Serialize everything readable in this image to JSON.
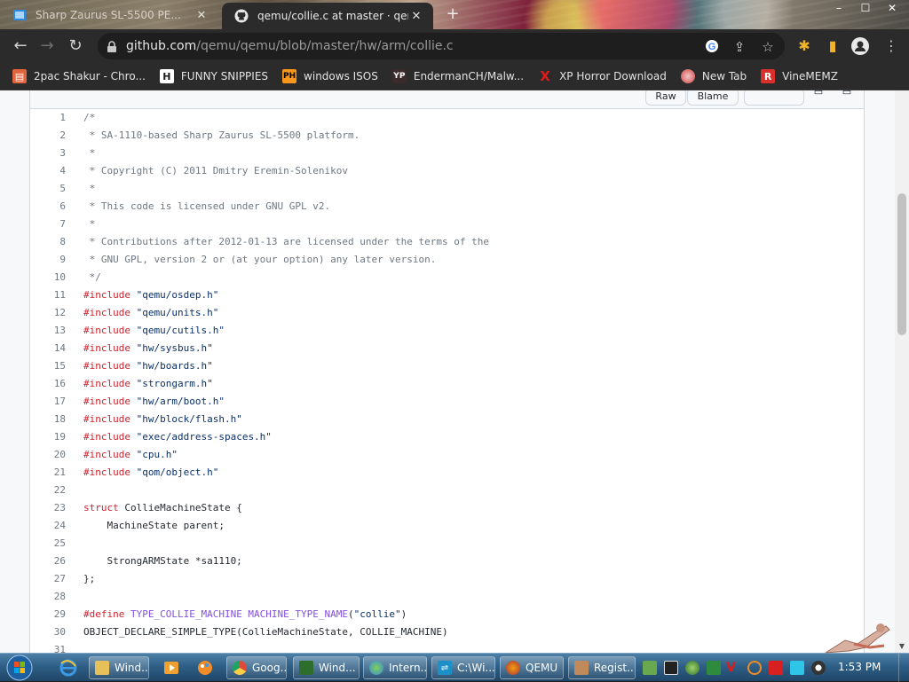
{
  "tabs": [
    {
      "title": "Sharp Zaurus SL-5500 PE...",
      "active": false
    },
    {
      "title": "qemu/collie.c at master · qemu/...",
      "active": true
    }
  ],
  "window_controls": {
    "minimize": "–",
    "maximize": "☐",
    "close": "✕"
  },
  "address_bar": {
    "host": "github.com",
    "path": "/qemu/qemu/blob/master/hw/arm/collie.c"
  },
  "bookmarks": [
    {
      "label": "2pac Shakur - Chro...",
      "icon": "ie-icon",
      "color": "#e0643c"
    },
    {
      "label": "FUNNY SNIPPIES",
      "icon": "H",
      "color": "#1a1a1a"
    },
    {
      "label": "windows ISOS",
      "icon": "PH",
      "color": "#f7971e"
    },
    {
      "label": "EndermanCH/Malw...",
      "icon": "YP",
      "color": "#3a2a2a"
    },
    {
      "label": "XP Horror Download",
      "icon": "X",
      "color": "#cc1111"
    },
    {
      "label": "New Tab",
      "icon": "globe",
      "color": "#c44"
    },
    {
      "label": "VineMEMZ",
      "icon": "R",
      "color": "#d9302b"
    }
  ],
  "file_header": {
    "raw": "Raw",
    "blame": "Blame"
  },
  "code_lines": [
    {
      "n": "1",
      "parts": [
        {
          "t": "/*",
          "c": "c-com"
        }
      ]
    },
    {
      "n": "2",
      "parts": [
        {
          "t": " * SA-1110-based Sharp Zaurus SL-5500 platform.",
          "c": "c-com"
        }
      ]
    },
    {
      "n": "3",
      "parts": [
        {
          "t": " *",
          "c": "c-com"
        }
      ]
    },
    {
      "n": "4",
      "parts": [
        {
          "t": " * Copyright (C) 2011 Dmitry Eremin-Solenikov",
          "c": "c-com"
        }
      ]
    },
    {
      "n": "5",
      "parts": [
        {
          "t": " *",
          "c": "c-com"
        }
      ]
    },
    {
      "n": "6",
      "parts": [
        {
          "t": " * This code is licensed under GNU GPL v2.",
          "c": "c-com"
        }
      ]
    },
    {
      "n": "7",
      "parts": [
        {
          "t": " *",
          "c": "c-com"
        }
      ]
    },
    {
      "n": "8",
      "parts": [
        {
          "t": " * Contributions after 2012-01-13 are licensed under the terms of the",
          "c": "c-com"
        }
      ]
    },
    {
      "n": "9",
      "parts": [
        {
          "t": " * GNU GPL, version 2 or (at your option) any later version.",
          "c": "c-com"
        }
      ]
    },
    {
      "n": "10",
      "parts": [
        {
          "t": " */",
          "c": "c-com"
        }
      ]
    },
    {
      "n": "11",
      "parts": [
        {
          "t": "#include",
          "c": "c-kw"
        },
        {
          "t": " ",
          "c": ""
        },
        {
          "t": "\"qemu/osdep.h\"",
          "c": "c-str"
        }
      ]
    },
    {
      "n": "12",
      "parts": [
        {
          "t": "#include",
          "c": "c-kw"
        },
        {
          "t": " ",
          "c": ""
        },
        {
          "t": "\"qemu/units.h\"",
          "c": "c-str"
        }
      ]
    },
    {
      "n": "13",
      "parts": [
        {
          "t": "#include",
          "c": "c-kw"
        },
        {
          "t": " ",
          "c": ""
        },
        {
          "t": "\"qemu/cutils.h\"",
          "c": "c-str"
        }
      ]
    },
    {
      "n": "14",
      "parts": [
        {
          "t": "#include",
          "c": "c-kw"
        },
        {
          "t": " ",
          "c": ""
        },
        {
          "t": "\"hw/sysbus.h\"",
          "c": "c-str"
        }
      ]
    },
    {
      "n": "15",
      "parts": [
        {
          "t": "#include",
          "c": "c-kw"
        },
        {
          "t": " ",
          "c": ""
        },
        {
          "t": "\"hw/boards.h\"",
          "c": "c-str"
        }
      ]
    },
    {
      "n": "16",
      "parts": [
        {
          "t": "#include",
          "c": "c-kw"
        },
        {
          "t": " ",
          "c": ""
        },
        {
          "t": "\"strongarm.h\"",
          "c": "c-str"
        }
      ]
    },
    {
      "n": "17",
      "parts": [
        {
          "t": "#include",
          "c": "c-kw"
        },
        {
          "t": " ",
          "c": ""
        },
        {
          "t": "\"hw/arm/boot.h\"",
          "c": "c-str"
        }
      ]
    },
    {
      "n": "18",
      "parts": [
        {
          "t": "#include",
          "c": "c-kw"
        },
        {
          "t": " ",
          "c": ""
        },
        {
          "t": "\"hw/block/flash.h\"",
          "c": "c-str"
        }
      ]
    },
    {
      "n": "19",
      "parts": [
        {
          "t": "#include",
          "c": "c-kw"
        },
        {
          "t": " ",
          "c": ""
        },
        {
          "t": "\"exec/address-spaces.h\"",
          "c": "c-str"
        }
      ]
    },
    {
      "n": "20",
      "parts": [
        {
          "t": "#include",
          "c": "c-kw"
        },
        {
          "t": " ",
          "c": ""
        },
        {
          "t": "\"cpu.h\"",
          "c": "c-str"
        }
      ]
    },
    {
      "n": "21",
      "parts": [
        {
          "t": "#include",
          "c": "c-kw"
        },
        {
          "t": " ",
          "c": ""
        },
        {
          "t": "\"qom/object.h\"",
          "c": "c-str"
        }
      ]
    },
    {
      "n": "22",
      "parts": []
    },
    {
      "n": "23",
      "parts": [
        {
          "t": "struct",
          "c": "c-kw"
        },
        {
          "t": " CollieMachineState {",
          "c": ""
        }
      ]
    },
    {
      "n": "24",
      "parts": [
        {
          "t": "    MachineState parent;",
          "c": ""
        }
      ]
    },
    {
      "n": "25",
      "parts": []
    },
    {
      "n": "26",
      "parts": [
        {
          "t": "    StrongARMState *sa1110;",
          "c": ""
        }
      ]
    },
    {
      "n": "27",
      "parts": [
        {
          "t": "};",
          "c": ""
        }
      ]
    },
    {
      "n": "28",
      "parts": []
    },
    {
      "n": "29",
      "parts": [
        {
          "t": "#define",
          "c": "c-kw"
        },
        {
          "t": " ",
          "c": ""
        },
        {
          "t": "TYPE_COLLIE_MACHINE MACHINE_TYPE_NAME",
          "c": "c-ent"
        },
        {
          "t": "(",
          "c": ""
        },
        {
          "t": "\"collie\"",
          "c": "c-str"
        },
        {
          "t": ")",
          "c": ""
        }
      ]
    },
    {
      "n": "30",
      "parts": [
        {
          "t": "OBJECT_DECLARE_SIMPLE_TYPE(CollieMachineState, COLLIE_MACHINE)",
          "c": ""
        }
      ]
    },
    {
      "n": "31",
      "parts": []
    }
  ],
  "taskbar": {
    "tasks": [
      {
        "label": "Wind...",
        "icon": "folder-icon",
        "color": "#e8c05a"
      },
      {
        "label": "Goog...",
        "icon": "chrome-icon",
        "color": "#dd4b39"
      },
      {
        "label": "Wind...",
        "icon": "terminal-icon",
        "color": "#2d6e2d"
      },
      {
        "label": "Intern...",
        "icon": "globe-icon",
        "color": "#3a8ad8"
      },
      {
        "label": "C:\\Wi...",
        "icon": "cmd-icon",
        "color": "#1e90c8"
      },
      {
        "label": "QEMU",
        "icon": "qemu-icon",
        "color": "#d35400"
      },
      {
        "label": "Regist...",
        "icon": "registry-icon",
        "color": "#c08a5a"
      }
    ],
    "clock": "1:53 PM"
  },
  "colors": {
    "accent": "#0969da",
    "comment": "#6e7781",
    "keyword": "#cf222e",
    "string": "#0a3069",
    "entity": "#8250df"
  }
}
